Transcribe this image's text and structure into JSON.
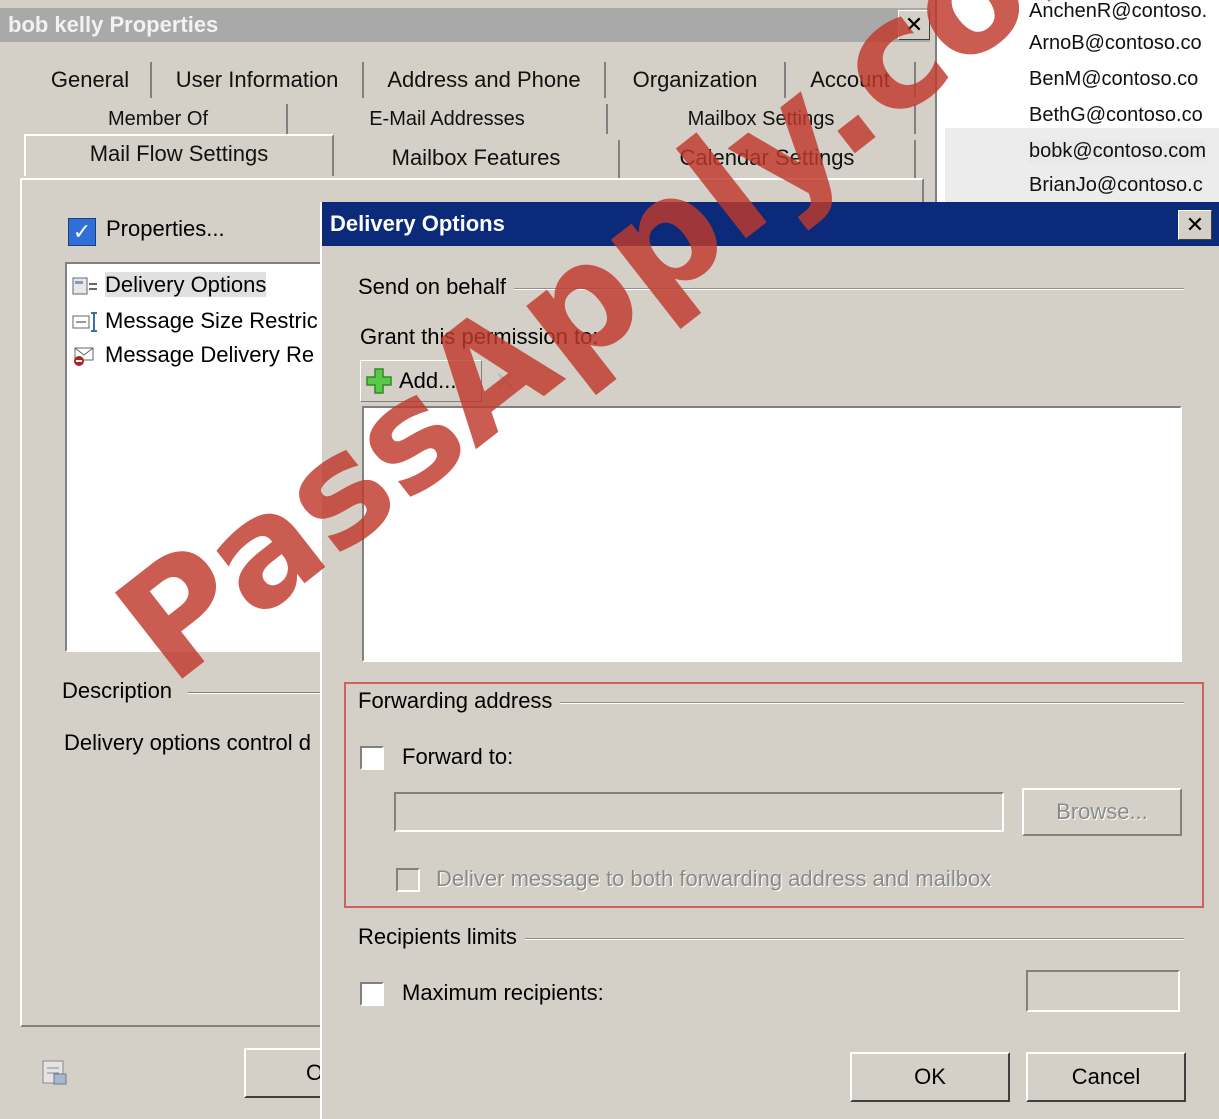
{
  "background_list": {
    "emails": [
      "AnchenR@contoso.",
      "ArnoB@contoso.co",
      "BenM@contoso.co",
      "BethG@contoso.co",
      "bobk@contoso.com",
      "BrianJo@contoso.c"
    ],
    "selected_index": 4
  },
  "parent_window": {
    "title": "bob kelly Properties",
    "close_glyph": "✕",
    "tabs_row1": [
      "General",
      "User Information",
      "Address and Phone",
      "Organization",
      "Account"
    ],
    "tabs_row2": [
      "Member Of",
      "E-Mail Addresses",
      "Mailbox Settings"
    ],
    "tabs_row3": [
      "Mail Flow Settings",
      "Mailbox Features",
      "Calendar Settings"
    ],
    "active_tab": "Mail Flow Settings",
    "properties_button": "Properties...",
    "features": [
      "Delivery Options",
      "Message Size Restric",
      "Message Delivery Re"
    ],
    "description_label": "Description",
    "description_text": "Delivery options control d",
    "ok_partial": "O"
  },
  "dialog": {
    "title": "Delivery Options",
    "close_glyph": "✕",
    "send_on_behalf": {
      "group_label": "Send on behalf",
      "grant_label": "Grant this permission to:",
      "add_button": "Add...",
      "remove_glyph": "✕",
      "permissions": []
    },
    "forwarding": {
      "group_label": "Forwarding address",
      "forward_to_label": "Forward to:",
      "forward_to_checked": false,
      "forward_value": "",
      "browse_button": "Browse...",
      "deliver_both_label": "Deliver message to both forwarding address and mailbox",
      "deliver_both_checked": false
    },
    "recipients": {
      "group_label": "Recipients limits",
      "max_label": "Maximum recipients:",
      "max_checked": false,
      "max_value": ""
    },
    "ok_button": "OK",
    "cancel_button": "Cancel"
  },
  "watermark": "PassApply.com",
  "colors": {
    "dialog_title_bg": "#0b2a7a",
    "window_face": "#d4d0c8",
    "highlight_frame": "#d06060",
    "watermark": "#c0392b"
  }
}
